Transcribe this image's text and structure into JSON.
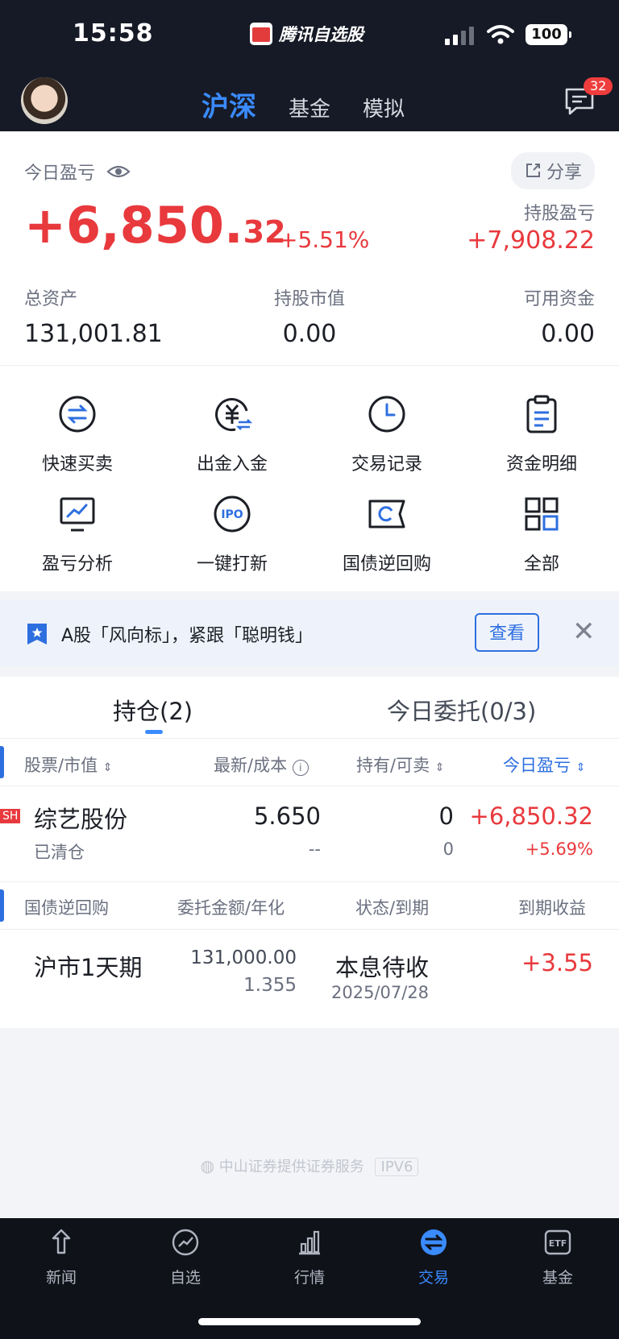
{
  "status_bar": {
    "time": "15:58",
    "app_name": "腾讯自选股",
    "battery": "100"
  },
  "header": {
    "tabs": [
      {
        "label": "沪深",
        "active": true
      },
      {
        "label": "基金",
        "active": false
      },
      {
        "label": "模拟",
        "active": false
      }
    ],
    "message_count": "32"
  },
  "summary": {
    "today_label": "今日盈亏",
    "share_label": "分享",
    "today_pnl_int": "+6,850.",
    "today_pnl_dec": "32",
    "today_pct": "+5.51%",
    "holding_pnl_label": "持股盈亏",
    "holding_pnl": "+7,908.22",
    "total_assets_label": "总资产",
    "total_assets": "131,001.81",
    "market_value_label": "持股市值",
    "market_value": "0.00",
    "available_label": "可用资金",
    "available": "0.00"
  },
  "actions": [
    {
      "label": "快速买卖",
      "icon": "swap-circle-icon"
    },
    {
      "label": "出金入金",
      "icon": "yuan-transfer-icon"
    },
    {
      "label": "交易记录",
      "icon": "clock-icon"
    },
    {
      "label": "资金明细",
      "icon": "clipboard-icon"
    },
    {
      "label": "盈亏分析",
      "icon": "monitor-chart-icon"
    },
    {
      "label": "一键打新",
      "icon": "ipo-icon"
    },
    {
      "label": "国债逆回购",
      "icon": "ticket-icon"
    },
    {
      "label": "全部",
      "icon": "grid-icon"
    }
  ],
  "banner": {
    "text": "A股「风向标」，紧跟「聪明钱」",
    "button": "查看"
  },
  "holdings": {
    "tab_positions": "持仓(2)",
    "tab_orders": "今日委托(0/3)",
    "headers": [
      "股票/市值",
      "最新/成本",
      "持有/可卖",
      "今日盈亏"
    ],
    "stock": {
      "market_tag": "SH",
      "name": "综艺股份",
      "sub": "已清仓",
      "latest": "5.650",
      "cost": "--",
      "hold": "0",
      "sellable": "0",
      "pnl": "+6,850.32",
      "pnl_pct": "+5.69%"
    },
    "repo_headers": [
      "国债逆回购",
      "委托金额/年化",
      "状态/到期",
      "到期收益"
    ],
    "repo": {
      "name": "沪市1天期",
      "amount": "131,000.00",
      "rate": "1.355",
      "status": "本息待收",
      "due": "2025/07/28",
      "income": "+3.55"
    }
  },
  "footer_note": {
    "text": "中山证券提供证券服务",
    "tag": "IPV6"
  },
  "bottom_nav": [
    {
      "label": "新闻",
      "icon": "news-icon",
      "active": false
    },
    {
      "label": "自选",
      "icon": "favorites-chart-icon",
      "active": false
    },
    {
      "label": "行情",
      "icon": "bar-chart-icon",
      "active": false
    },
    {
      "label": "交易",
      "icon": "exchange-icon",
      "active": true
    },
    {
      "label": "基金",
      "icon": "etf-icon",
      "active": false
    }
  ],
  "colors": {
    "red": "#e8393d",
    "blue": "#3a8bff",
    "header_bg": "#161a26"
  }
}
